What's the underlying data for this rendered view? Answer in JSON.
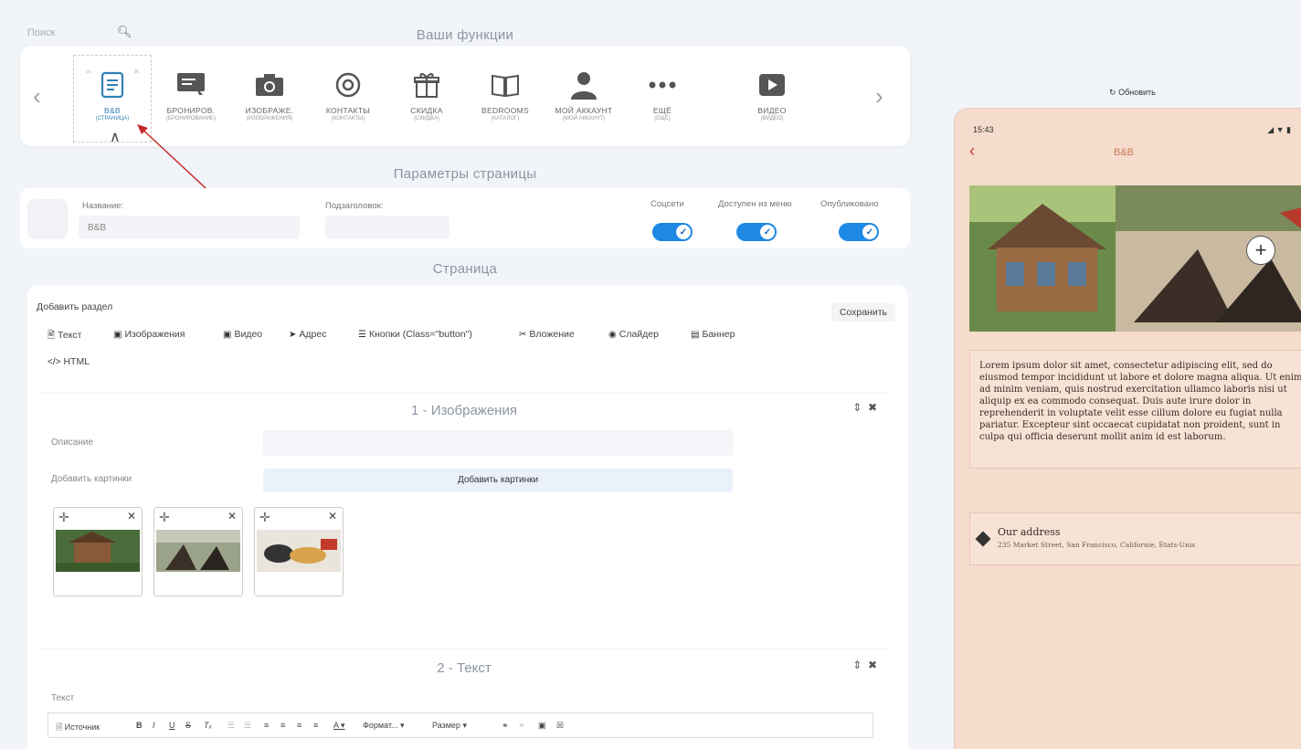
{
  "search": {
    "placeholder": "Поиск"
  },
  "features_title": "Ваши функции",
  "features": [
    {
      "label": "B&B",
      "sub": "(СТРАНИЦА)",
      "icon": "page-icon"
    },
    {
      "label": "БРОНИРОВ.",
      "sub": "(БРОНИРОВАНИЕ)",
      "icon": "booking-icon"
    },
    {
      "label": "ИЗОБРАЖЕ.",
      "sub": "(ИЗОБРАЖЕНИЯ)",
      "icon": "camera-icon"
    },
    {
      "label": "КОНТАКТЫ",
      "sub": "(КОНТАКТЫ)",
      "icon": "contact-icon"
    },
    {
      "label": "СКИДКА",
      "sub": "(СКИДКА)",
      "icon": "gift-icon"
    },
    {
      "label": "BEDROOMS",
      "sub": "(КАТАЛОГ)",
      "icon": "book-icon"
    },
    {
      "label": "МОЙ АККАУНТ",
      "sub": "(МОЙ АККАУНТ)",
      "icon": "user-icon"
    },
    {
      "label": "ЕЩЁ",
      "sub": "(ЕЩЁ)",
      "icon": "more-icon"
    },
    {
      "label": "ВИДЕО",
      "sub": "(ВИДЕО)",
      "icon": "video-icon"
    }
  ],
  "params_title": "Параметры страницы",
  "params": {
    "name_label": "Название:",
    "name_value": "B&B",
    "subtitle_label": "Подзаголовок:",
    "subtitle_value": "",
    "toggles": [
      {
        "label": "Соцсети",
        "on": true
      },
      {
        "label": "Доступен из меню",
        "on": true
      },
      {
        "label": "Опубликовано",
        "on": true
      }
    ]
  },
  "page_title": "Страница",
  "editor": {
    "add_section": "Добавить раздел",
    "save": "Сохранить",
    "tools": [
      {
        "label": "Текст",
        "icon": "text-icon"
      },
      {
        "label": "Изображения",
        "icon": "image-icon"
      },
      {
        "label": "Видео",
        "icon": "video-icon"
      },
      {
        "label": "Адрес",
        "icon": "location-icon"
      },
      {
        "label": "Кнопки (Class=\"button\")",
        "icon": "buttons-icon"
      },
      {
        "label": "Вложение",
        "icon": "attachment-icon"
      },
      {
        "label": "Слайдер",
        "icon": "slider-icon"
      },
      {
        "label": "Баннер",
        "icon": "banner-icon"
      },
      {
        "label": "HTML",
        "icon": "code-icon"
      }
    ]
  },
  "block1": {
    "title": "1 - Изображения",
    "desc_label": "Описание",
    "add_label": "Добавить картинки",
    "add_button": "Добавить картинки"
  },
  "block2": {
    "title": "2 - Текст",
    "text_label": "Текст",
    "toolbar": {
      "source": "Источник",
      "format": "Формат...",
      "size": "Размер"
    }
  },
  "preview": {
    "refresh": "Обновить",
    "time": "15:43",
    "title": "B&B",
    "text": "Lorem ipsum dolor sit amet, consectetur adipiscing elit, sed do eiusmod tempor incididunt ut labore et dolore magna aliqua. Ut enim ad minim veniam, quis nostrud exercitation ullamco laboris nisi ut aliquip ex ea commodo consequat. Duis aute irure dolor in reprehenderit in voluptate velit esse cillum dolore eu fugiat nulla pariatur. Excepteur sint occaecat cupidatat non proident, sunt in culpa qui officia deserunt mollit anim id est laborum.",
    "address_title": "Our address",
    "address_text": "235 Market Street, San Francisco, Californie, États-Unis"
  },
  "colors": {
    "accent": "#1e88e5",
    "arrow": "#c62828",
    "preview_bg": "#f5dccd"
  }
}
